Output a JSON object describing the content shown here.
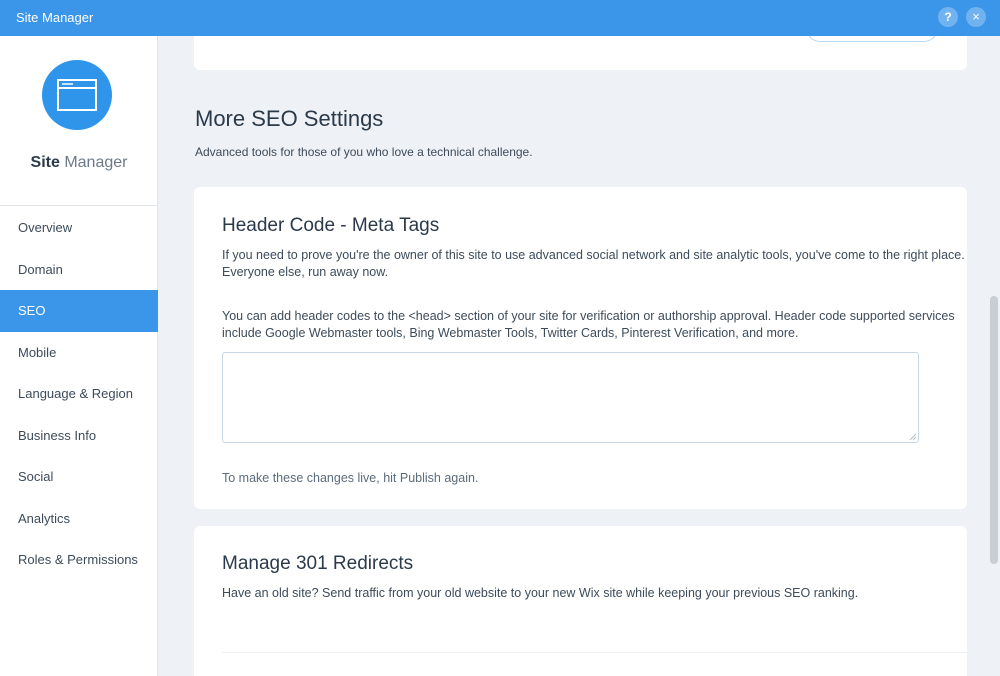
{
  "window": {
    "title": "Site Manager",
    "help_label": "?",
    "close_label": "×"
  },
  "sidebar": {
    "site_name_bold": "Site",
    "site_name_rest": " Manager",
    "items": [
      {
        "label": "Overview"
      },
      {
        "label": "Domain"
      },
      {
        "label": "SEO"
      },
      {
        "label": "Mobile"
      },
      {
        "label": "Language & Region"
      },
      {
        "label": "Business Info"
      },
      {
        "label": "Social"
      },
      {
        "label": "Analytics"
      },
      {
        "label": "Roles & Permissions"
      }
    ],
    "active_item": "SEO"
  },
  "main": {
    "section_title": "More SEO Settings",
    "section_subtitle": "Advanced tools for those of you who love a technical challenge.",
    "header_code": {
      "title": "Header Code - Meta Tags",
      "paragraph1": "If you need to prove you're the owner of this site to use advanced social network and site analytic tools, you've come to the right place. Everyone else, run away now.",
      "paragraph2": "You can add header codes to the <head> section of your site for verification or authorship approval. Header code supported services include Google Webmaster tools, Bing Webmaster Tools, Twitter Cards, Pinterest Verification, and more.",
      "code_value": "",
      "note": "To make these changes live, hit Publish again."
    },
    "redirects": {
      "title": "Manage 301 Redirects",
      "paragraph": "Have an old site? Send traffic from your old website to your new Wix site while keeping your previous SEO ranking."
    }
  },
  "colors": {
    "accent": "#3b96ea",
    "background": "#eef1f5",
    "card": "#ffffff",
    "text": "#2b3a4a"
  },
  "icons": {
    "logo": "browser-window-icon",
    "help": "help-icon",
    "close": "close-icon"
  }
}
